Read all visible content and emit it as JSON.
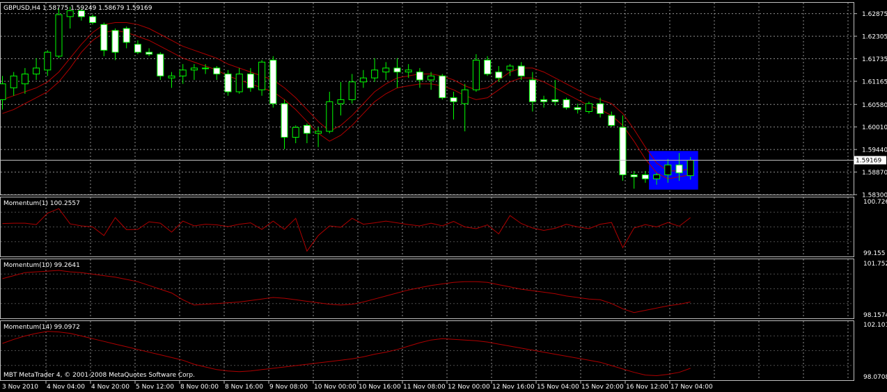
{
  "main": {
    "symbol_label": "GBPUSD,H4  1.58775 1.59249 1.58679 1.59169",
    "price_ticks": [
      "1.62875",
      "1.62305",
      "1.61735",
      "1.61165",
      "1.60580",
      "1.60010",
      "1.59440",
      "1.58870",
      "1.58300"
    ],
    "current_price_label": "1.59169",
    "copyright": "MBT MetaTrader 4, © 2001-2008 MetaQuotes Software Corp."
  },
  "time_labels": [
    "3 Nov 2010",
    "4 Nov 04:00",
    "4 Nov 20:00",
    "5 Nov 12:00",
    "8 Nov 00:00",
    "8 Nov 16:00",
    "9 Nov 08:00",
    "10 Nov 00:00",
    "10 Nov 16:00",
    "11 Nov 08:00",
    "12 Nov 00:00",
    "12 Nov 16:00",
    "15 Nov 04:00",
    "15 Nov 20:00",
    "16 Nov 12:00",
    "17 Nov 04:00"
  ],
  "indicators": [
    {
      "label": "Momentum(1) 100.2557",
      "max_label": "100.726",
      "min_label": "99.155"
    },
    {
      "label": "Momentum(10) 99.2641",
      "max_label": "101.752",
      "min_label": "98.1574"
    },
    {
      "label": "Momentum(14) 99.0972",
      "max_label": "102.101",
      "min_label": "98.0708"
    }
  ],
  "colors": {
    "background": "#000000",
    "grid": "#c0c0c0",
    "text": "#ffffff",
    "bull_body": "#000000",
    "bear_body": "#ffffff",
    "wick": "#00ff00",
    "ma_line": "#b00000",
    "indicator_line": "#b00000",
    "highlight": "#0000ff",
    "price_line": "#c0c0c0"
  },
  "chart_data": {
    "type": "candlestick",
    "symbol": "GBPUSD",
    "timeframe": "H4",
    "ylim": [
      1.583,
      1.6315
    ],
    "grid": true,
    "candles": [
      {
        "o": 1.607,
        "h": 1.613,
        "l": 1.6045,
        "c": 1.611
      },
      {
        "o": 1.61,
        "h": 1.614,
        "l": 1.608,
        "c": 1.613
      },
      {
        "o": 1.611,
        "h": 1.615,
        "l": 1.6085,
        "c": 1.6135
      },
      {
        "o": 1.6135,
        "h": 1.6175,
        "l": 1.612,
        "c": 1.615
      },
      {
        "o": 1.6145,
        "h": 1.6195,
        "l": 1.613,
        "c": 1.619
      },
      {
        "o": 1.618,
        "h": 1.63,
        "l": 1.6175,
        "c": 1.6285
      },
      {
        "o": 1.628,
        "h": 1.6305,
        "l": 1.625,
        "c": 1.6295
      },
      {
        "o": 1.6295,
        "h": 1.63,
        "l": 1.627,
        "c": 1.628
      },
      {
        "o": 1.628,
        "h": 1.6285,
        "l": 1.626,
        "c": 1.6265
      },
      {
        "o": 1.626,
        "h": 1.6265,
        "l": 1.618,
        "c": 1.6195
      },
      {
        "o": 1.6245,
        "h": 1.625,
        "l": 1.617,
        "c": 1.619
      },
      {
        "o": 1.625,
        "h": 1.6255,
        "l": 1.62,
        "c": 1.6215
      },
      {
        "o": 1.621,
        "h": 1.622,
        "l": 1.6185,
        "c": 1.619
      },
      {
        "o": 1.619,
        "h": 1.62,
        "l": 1.618,
        "c": 1.6185
      },
      {
        "o": 1.6185,
        "h": 1.619,
        "l": 1.612,
        "c": 1.613
      },
      {
        "o": 1.6125,
        "h": 1.614,
        "l": 1.61,
        "c": 1.613
      },
      {
        "o": 1.613,
        "h": 1.616,
        "l": 1.611,
        "c": 1.6145
      },
      {
        "o": 1.6145,
        "h": 1.616,
        "l": 1.612,
        "c": 1.615
      },
      {
        "o": 1.615,
        "h": 1.616,
        "l": 1.6135,
        "c": 1.615
      },
      {
        "o": 1.615,
        "h": 1.6155,
        "l": 1.612,
        "c": 1.6135
      },
      {
        "o": 1.6135,
        "h": 1.6145,
        "l": 1.608,
        "c": 1.609
      },
      {
        "o": 1.609,
        "h": 1.615,
        "l": 1.6085,
        "c": 1.6135
      },
      {
        "o": 1.6135,
        "h": 1.615,
        "l": 1.609,
        "c": 1.61
      },
      {
        "o": 1.6095,
        "h": 1.617,
        "l": 1.608,
        "c": 1.6165
      },
      {
        "o": 1.617,
        "h": 1.618,
        "l": 1.605,
        "c": 1.606
      },
      {
        "o": 1.606,
        "h": 1.607,
        "l": 1.5945,
        "c": 1.5975
      },
      {
        "o": 1.5975,
        "h": 1.6005,
        "l": 1.596,
        "c": 1.6
      },
      {
        "o": 1.6005,
        "h": 1.601,
        "l": 1.596,
        "c": 1.5985
      },
      {
        "o": 1.5985,
        "h": 1.6,
        "l": 1.595,
        "c": 1.599
      },
      {
        "o": 1.599,
        "h": 1.609,
        "l": 1.5985,
        "c": 1.6065
      },
      {
        "o": 1.606,
        "h": 1.6115,
        "l": 1.603,
        "c": 1.607
      },
      {
        "o": 1.607,
        "h": 1.6135,
        "l": 1.606,
        "c": 1.6115
      },
      {
        "o": 1.6115,
        "h": 1.6145,
        "l": 1.61,
        "c": 1.6125
      },
      {
        "o": 1.6125,
        "h": 1.6175,
        "l": 1.6115,
        "c": 1.6145
      },
      {
        "o": 1.614,
        "h": 1.6165,
        "l": 1.612,
        "c": 1.615
      },
      {
        "o": 1.615,
        "h": 1.6175,
        "l": 1.61,
        "c": 1.614
      },
      {
        "o": 1.614,
        "h": 1.616,
        "l": 1.6125,
        "c": 1.6145
      },
      {
        "o": 1.614,
        "h": 1.615,
        "l": 1.61,
        "c": 1.612
      },
      {
        "o": 1.612,
        "h": 1.614,
        "l": 1.6095,
        "c": 1.613
      },
      {
        "o": 1.613,
        "h": 1.6135,
        "l": 1.607,
        "c": 1.6075
      },
      {
        "o": 1.6075,
        "h": 1.609,
        "l": 1.602,
        "c": 1.6065
      },
      {
        "o": 1.606,
        "h": 1.611,
        "l": 1.599,
        "c": 1.6095
      },
      {
        "o": 1.6095,
        "h": 1.6185,
        "l": 1.609,
        "c": 1.617
      },
      {
        "o": 1.617,
        "h": 1.618,
        "l": 1.613,
        "c": 1.6135
      },
      {
        "o": 1.614,
        "h": 1.6155,
        "l": 1.6115,
        "c": 1.6125
      },
      {
        "o": 1.6145,
        "h": 1.616,
        "l": 1.613,
        "c": 1.6155
      },
      {
        "o": 1.6155,
        "h": 1.6165,
        "l": 1.612,
        "c": 1.613
      },
      {
        "o": 1.612,
        "h": 1.614,
        "l": 1.604,
        "c": 1.6065
      },
      {
        "o": 1.607,
        "h": 1.608,
        "l": 1.605,
        "c": 1.6065
      },
      {
        "o": 1.607,
        "h": 1.612,
        "l": 1.6055,
        "c": 1.6065
      },
      {
        "o": 1.607,
        "h": 1.6075,
        "l": 1.6045,
        "c": 1.605
      },
      {
        "o": 1.605,
        "h": 1.606,
        "l": 1.6035,
        "c": 1.6045
      },
      {
        "o": 1.604,
        "h": 1.6065,
        "l": 1.6035,
        "c": 1.606
      },
      {
        "o": 1.606,
        "h": 1.6075,
        "l": 1.6025,
        "c": 1.6035
      },
      {
        "o": 1.603,
        "h": 1.604,
        "l": 1.6,
        "c": 1.6005
      },
      {
        "o": 1.6,
        "h": 1.603,
        "l": 1.5865,
        "c": 1.588
      },
      {
        "o": 1.588,
        "h": 1.589,
        "l": 1.5845,
        "c": 1.5875
      },
      {
        "o": 1.588,
        "h": 1.589,
        "l": 1.586,
        "c": 1.587
      },
      {
        "o": 1.587,
        "h": 1.5885,
        "l": 1.5855,
        "c": 1.588
      },
      {
        "o": 1.588,
        "h": 1.592,
        "l": 1.586,
        "c": 1.5905
      },
      {
        "o": 1.5905,
        "h": 1.5935,
        "l": 1.5865,
        "c": 1.5885
      },
      {
        "o": 1.5878,
        "h": 1.5925,
        "l": 1.5868,
        "c": 1.5917
      }
    ],
    "ma": [
      1.607,
      1.608,
      1.609,
      1.61,
      1.6115,
      1.614,
      1.6175,
      1.621,
      1.624,
      1.626,
      1.6265,
      1.6265,
      1.626,
      1.625,
      1.6235,
      1.622,
      1.6205,
      1.6195,
      1.6185,
      1.6175,
      1.616,
      1.615,
      1.614,
      1.613,
      1.612,
      1.61,
      1.6075,
      1.6045,
      1.6015,
      1.599,
      1.6005,
      1.603,
      1.606,
      1.609,
      1.611,
      1.6125,
      1.613,
      1.6135,
      1.6135,
      1.613,
      1.612,
      1.6105,
      1.6095,
      1.61,
      1.612,
      1.614,
      1.615,
      1.615,
      1.614,
      1.6125,
      1.611,
      1.6095,
      1.608,
      1.607,
      1.606,
      1.6035,
      1.5995,
      1.595,
      1.591,
      1.589,
      1.589,
      1.5895
    ],
    "ma2": [
      1.6035,
      1.6045,
      1.606,
      1.6075,
      1.609,
      1.6115,
      1.615,
      1.619,
      1.622,
      1.624,
      1.6245,
      1.624,
      1.623,
      1.622,
      1.6205,
      1.619,
      1.6175,
      1.6165,
      1.6155,
      1.6145,
      1.613,
      1.612,
      1.611,
      1.61,
      1.609,
      1.607,
      1.6045,
      1.6015,
      1.5985,
      1.5965,
      1.598,
      1.6005,
      1.6035,
      1.6065,
      1.6085,
      1.61,
      1.6105,
      1.611,
      1.611,
      1.6105,
      1.6095,
      1.608,
      1.607,
      1.6075,
      1.6095,
      1.6115,
      1.6125,
      1.6125,
      1.6115,
      1.61,
      1.6085,
      1.607,
      1.6055,
      1.6045,
      1.603,
      1.6005,
      1.5965,
      1.592,
      1.5885,
      1.587,
      1.5875,
      1.588
    ],
    "momentum1": {
      "ylim": [
        99.155,
        100.726
      ],
      "values": [
        100.05,
        100.06,
        100.06,
        100.02,
        100.35,
        100.48,
        100.04,
        99.98,
        99.95,
        99.7,
        100.22,
        99.87,
        99.88,
        100.1,
        100.06,
        99.8,
        100.12,
        99.98,
        100.03,
        100.01,
        99.96,
        100.03,
        100.07,
        99.88,
        100.12,
        99.88,
        100.2,
        99.25,
        99.7,
        99.98,
        99.94,
        100.2,
        100.03,
        100.07,
        100.12,
        100.07,
        100.02,
        99.98,
        100.06,
        99.98,
        100.11,
        99.95,
        99.9,
        100.01,
        99.75,
        100.28,
        100.05,
        99.92,
        99.85,
        99.91,
        100.03,
        99.95,
        99.9,
        100.03,
        100.08,
        99.35,
        99.92,
        100.02,
        99.95,
        100.08,
        99.97,
        100.22
      ]
    },
    "momentum10": {
      "ylim": [
        98.1574,
        101.752
      ],
      "values": [
        100.65,
        100.85,
        101.05,
        101.1,
        101.15,
        101.2,
        101.1,
        101.05,
        100.95,
        100.85,
        100.75,
        100.6,
        100.45,
        100.2,
        99.95,
        99.7,
        99.25,
        98.9,
        98.95,
        99.0,
        99.05,
        99.1,
        99.2,
        99.3,
        99.4,
        99.35,
        99.25,
        99.15,
        99.05,
        98.95,
        98.9,
        98.95,
        99.1,
        99.3,
        99.5,
        99.7,
        99.9,
        100.05,
        100.2,
        100.3,
        100.4,
        100.45,
        100.45,
        100.4,
        100.25,
        100.1,
        99.95,
        99.85,
        99.75,
        99.65,
        99.5,
        99.4,
        99.3,
        99.25,
        99.0,
        98.65,
        98.4,
        98.55,
        98.7,
        98.85,
        98.95,
        99.1
      ]
    },
    "momentum14": {
      "ylim": [
        98.0708,
        102.101
      ],
      "values": [
        100.65,
        100.95,
        101.2,
        101.4,
        101.55,
        101.5,
        101.4,
        101.2,
        101.0,
        100.8,
        100.6,
        100.4,
        100.2,
        100.0,
        99.8,
        99.6,
        99.4,
        99.1,
        98.9,
        98.7,
        98.6,
        98.55,
        98.6,
        98.7,
        98.8,
        98.9,
        99.0,
        99.1,
        99.2,
        99.3,
        99.4,
        99.5,
        99.65,
        99.85,
        100.0,
        100.2,
        100.45,
        100.7,
        100.9,
        101.0,
        100.95,
        100.9,
        100.85,
        100.75,
        100.6,
        100.45,
        100.3,
        100.15,
        100.0,
        99.85,
        99.7,
        99.55,
        99.4,
        99.25,
        99.0,
        98.75,
        98.5,
        98.3,
        98.25,
        98.35,
        98.5,
        98.8
      ]
    }
  }
}
